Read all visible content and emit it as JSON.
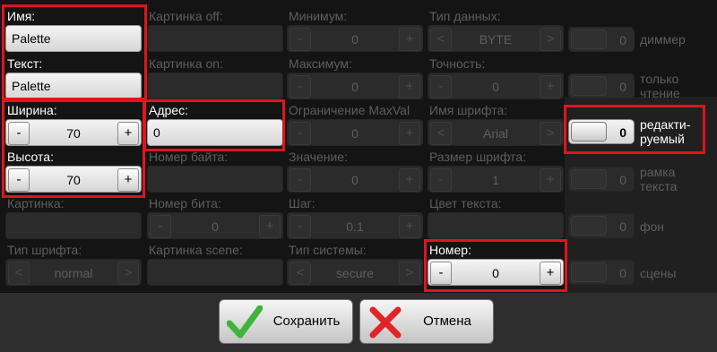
{
  "fields": {
    "name": {
      "label": "Имя:",
      "value": "Palette"
    },
    "text": {
      "label": "Текст:",
      "value": "Palette"
    },
    "width": {
      "label": "Ширина:",
      "value": "70"
    },
    "height": {
      "label": "Высота:",
      "value": "70"
    },
    "image": {
      "label": "Картинка:"
    },
    "font_type": {
      "label": "Тип шрифта:",
      "value": "normal"
    },
    "image_off": {
      "label": "Картинка off:"
    },
    "image_on": {
      "label": "Картинка on:"
    },
    "address": {
      "label": "Адрес:",
      "value": "0"
    },
    "byte_number": {
      "label": "Номер байта:"
    },
    "bit_number": {
      "label": "Номер бита:",
      "value": "0"
    },
    "image_scene": {
      "label": "Картинка scene:"
    },
    "minimum": {
      "label": "Минимум:",
      "value": "0"
    },
    "maximum": {
      "label": "Максимум:",
      "value": "0"
    },
    "limit_maxval": {
      "label": "Ограничение MaxVal",
      "value": "0"
    },
    "value": {
      "label": "Значение:",
      "value": "0"
    },
    "step": {
      "label": "Шаг:",
      "value": "0.1"
    },
    "system_type": {
      "label": "Тип системы:",
      "value": "secure"
    },
    "data_type": {
      "label": "Тип данных:",
      "value": "BYTE"
    },
    "precision": {
      "label": "Точность:",
      "value": "0"
    },
    "font_name": {
      "label": "Имя шрифта:",
      "value": "Arial"
    },
    "font_size": {
      "label": "Размер шрифта:",
      "value": "1"
    },
    "text_color": {
      "label": "Цвет текста:"
    },
    "number": {
      "label": "Номер:",
      "value": "0"
    }
  },
  "toggles": {
    "dimmer": {
      "value": "0",
      "caption": "диммер"
    },
    "read_only": {
      "value": "0",
      "caption": "только чтение"
    },
    "editable": {
      "value": "0",
      "caption": "редакти-руемый"
    },
    "frame": {
      "value": "0",
      "caption": "рамка текста"
    },
    "background": {
      "value": "0",
      "caption": "фон"
    },
    "scenes": {
      "value": "0",
      "caption": "сцены"
    }
  },
  "glyphs": {
    "minus": "-",
    "plus": "+",
    "prev": "<",
    "next": ">"
  },
  "buttons": {
    "save": {
      "label": "Сохранить",
      "icon": "check-icon"
    },
    "cancel": {
      "label": "Отмена",
      "icon": "cross-icon"
    }
  },
  "colors": {
    "highlight": "#e0141e",
    "check": "#3fb43c",
    "cross": "#e02428"
  }
}
